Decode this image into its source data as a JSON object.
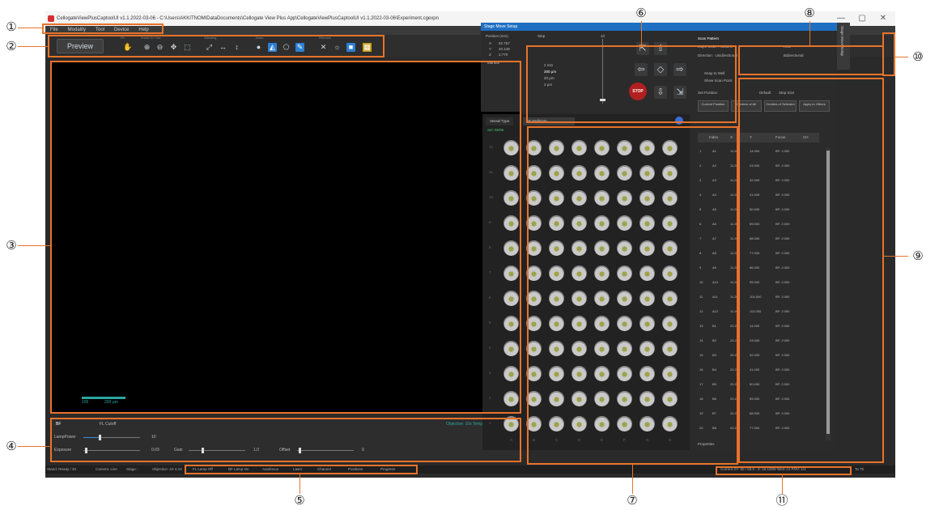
{
  "window": {
    "title": "CellogateViewPlusCaptoolUI v1.1.2022-03-06 - C:\\Users\\AKKITNOMIDataDocuments\\Cellogate View Plus App\\CellogateViewPlusCaptoolUI v1.1.2022-03-06\\Experiment.cgexpn",
    "minimize": "—",
    "maximize": "▢",
    "close": "✕"
  },
  "menu": [
    "File",
    "Modality",
    "Tool",
    "Device",
    "Help"
  ],
  "toolbar": {
    "preview_label": "Preview",
    "group_labels": [
      "Fit",
      "Zoom In / Out",
      "Stitching",
      "Draw",
      "Remove"
    ],
    "icons": [
      "hand-icon",
      "zoom-in-icon",
      "zoom-out-icon",
      "pan-icon",
      "select-icon",
      "fit-icon",
      "width-icon",
      "height-icon",
      "circle-icon",
      "draw-icon",
      "shape-icon",
      "pen-icon",
      "remove-icon",
      "light-icon",
      "square-icon",
      "grid-icon"
    ]
  },
  "viewer": {
    "scale_labels": [
      "100",
      "200 μm"
    ]
  },
  "adjust": {
    "tab_bf": "BF",
    "tab_fl": "FL Cutoff",
    "lamp_label": "LampPower",
    "lamp_value": "10",
    "exposure_label": "Exposure",
    "exposure_value": "0.03",
    "gain_label": "Gain",
    "gain_value": "1.0",
    "offset_label": "Offset",
    "offset_value": "0",
    "info": "Objective: 10x   Temp: 37.0°C"
  },
  "status": {
    "left": [
      "Stand: Ready / 30",
      "Camera: Live",
      "Stage: -",
      "Objective: 4X 0.10"
    ],
    "mid": [
      "FL  Lamp Off",
      "BF  Lamp On",
      "Autofocus",
      "Laser",
      "Channel",
      "Positions",
      "Progress"
    ],
    "right": "Current XY: 50 / 50.0 - Z: 15.1000/  Well: A1  FOV: 1/1",
    "far_right": "Ta  Tb"
  },
  "stage": {
    "header": "Stage Move Setup",
    "position_label": "Position (mm)",
    "x": "62.757",
    "y": "40.148",
    "z": "2.770",
    "manual_label": "Manual",
    "step_label": "Step",
    "steps": [
      "2 mm",
      "200 μm",
      "20 μm",
      "2 μm"
    ],
    "scale_top": "10",
    "stop_label": "STOP"
  },
  "vessel": {
    "tab_type": "Vessel Type",
    "tab_name": "96 Wellplate",
    "selection": "Sel: 96/96",
    "rows": [
      "12",
      "11",
      "10",
      "9",
      "8",
      "7",
      "6",
      "5",
      "4",
      "3",
      "2",
      "1"
    ],
    "cols": [
      "A",
      "B",
      "C",
      "D",
      "E",
      "F",
      "G",
      "H"
    ]
  },
  "scan": {
    "title": "Scan Pattern",
    "major_order": "Major Order : Column",
    "row": "Row",
    "direction": "Direction : Unidirectional",
    "bidirectional": "Bidirectional"
  },
  "wells": {
    "snap": "Snap to Well",
    "show_scan": "Show Scan Point",
    "set_position": "Set Position",
    "default": "Default",
    "stepsize": "Step Size",
    "buttons": [
      "Current Position",
      "Centers of All",
      "Centers of Selected",
      "Apply to Others"
    ],
    "headers": [
      "Index",
      "X",
      "Y",
      "Focus",
      "CH"
    ],
    "rows": [
      [
        "1",
        "A1",
        "11.200",
        "14.000"
      ],
      [
        "2",
        "A2",
        "11.200",
        "23.000"
      ],
      [
        "3",
        "A3",
        "11.200",
        "32.000"
      ],
      [
        "4",
        "A4",
        "11.200",
        "41.000"
      ],
      [
        "5",
        "A5",
        "11.200",
        "50.000"
      ],
      [
        "6",
        "A6",
        "11.200",
        "59.000"
      ],
      [
        "7",
        "A7",
        "11.200",
        "68.000"
      ],
      [
        "8",
        "A8",
        "11.200",
        "77.000"
      ],
      [
        "9",
        "A9",
        "11.200",
        "86.000"
      ],
      [
        "10",
        "A10",
        "11.200",
        "95.000"
      ],
      [
        "11",
        "A11",
        "11.200",
        "104.000"
      ],
      [
        "12",
        "A12",
        "11.200",
        "113.000"
      ],
      [
        "13",
        "B1",
        "20.200",
        "14.000"
      ],
      [
        "14",
        "B2",
        "20.200",
        "23.000"
      ],
      [
        "15",
        "B3",
        "20.200",
        "32.000"
      ],
      [
        "16",
        "B4",
        "20.200",
        "41.000"
      ],
      [
        "17",
        "B5",
        "20.200",
        "50.000"
      ],
      [
        "18",
        "B6",
        "20.200",
        "59.000"
      ],
      [
        "19",
        "B7",
        "20.200",
        "68.000"
      ],
      [
        "20",
        "B8",
        "20.200",
        "77.000"
      ]
    ],
    "focus_prefix": "BF: 2.000",
    "footer": "Properties"
  },
  "side_tab": "Stage Move Setup",
  "callouts": [
    "①",
    "②",
    "③",
    "④",
    "⑤",
    "⑥",
    "⑦",
    "⑧",
    "⑨",
    "⑩",
    "⑪"
  ]
}
